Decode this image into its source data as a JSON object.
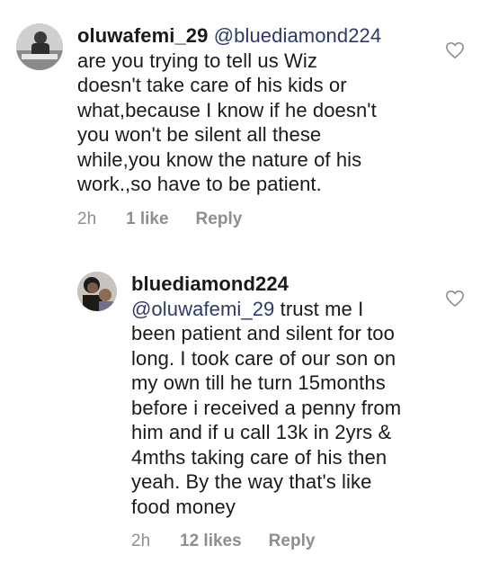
{
  "comments": [
    {
      "username": "oluwafemi_29",
      "mention": "@bluediamond224",
      "lines": [
        "are you trying to tell us Wiz",
        "doesn't take care of his kids or",
        "what,because I know if he doesn't",
        "you won't be silent all these",
        "while,you know the nature of his",
        "work.,so have to be patient."
      ],
      "time": "2h",
      "likes": "1 like",
      "reply": "Reply"
    },
    {
      "username": "bluediamond224",
      "mention": "@oluwafemi_29",
      "first_line_rest": "trust me I",
      "lines": [
        "been patient and silent for too",
        "long. I took care of our son on",
        "my own till he turn 15months",
        "before i received a penny from",
        "him and if u call 13k in 2yrs &",
        "4mths taking care of his then",
        "yeah. By the way that's like",
        "food money"
      ],
      "time": "2h",
      "likes": "12 likes",
      "reply": "Reply"
    }
  ],
  "icons": {
    "like": "heart-outline-icon"
  },
  "colors": {
    "text": "#1a1a1a",
    "meta": "#8e8e8e",
    "mention": "#2b3a67",
    "background": "#ffffff"
  }
}
